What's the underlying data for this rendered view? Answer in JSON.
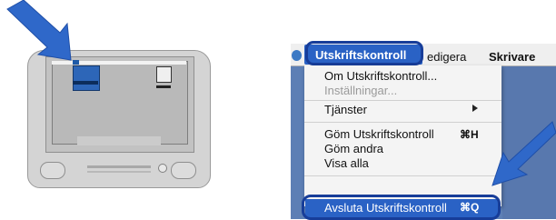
{
  "colors": {
    "arrow_blue": "#2f68c9",
    "highlight_outline": "#173d99",
    "menu_highlight": "#2a62c5",
    "desktop_blue": "#5d7fb5"
  },
  "menubar": {
    "app_menu": "Utskriftskontroll",
    "edit_menu_partial": "edigera",
    "printer_menu_partial": "Skrivare"
  },
  "menu": {
    "about": "Om Utskriftskontroll...",
    "preferences": "Inställningar...",
    "services": "Tjänster",
    "hide_app": "Göm Utskriftskontroll",
    "hide_app_shortcut": "⌘H",
    "hide_others": "Göm andra",
    "show_all": "Visa alla",
    "quit": "Avsluta Utskriftskontroll",
    "quit_shortcut": "⌘Q"
  },
  "icons": {
    "arrows": [
      "arrow-icon"
    ],
    "submenu": "chevron-right-icon",
    "apple": "apple-icon"
  }
}
